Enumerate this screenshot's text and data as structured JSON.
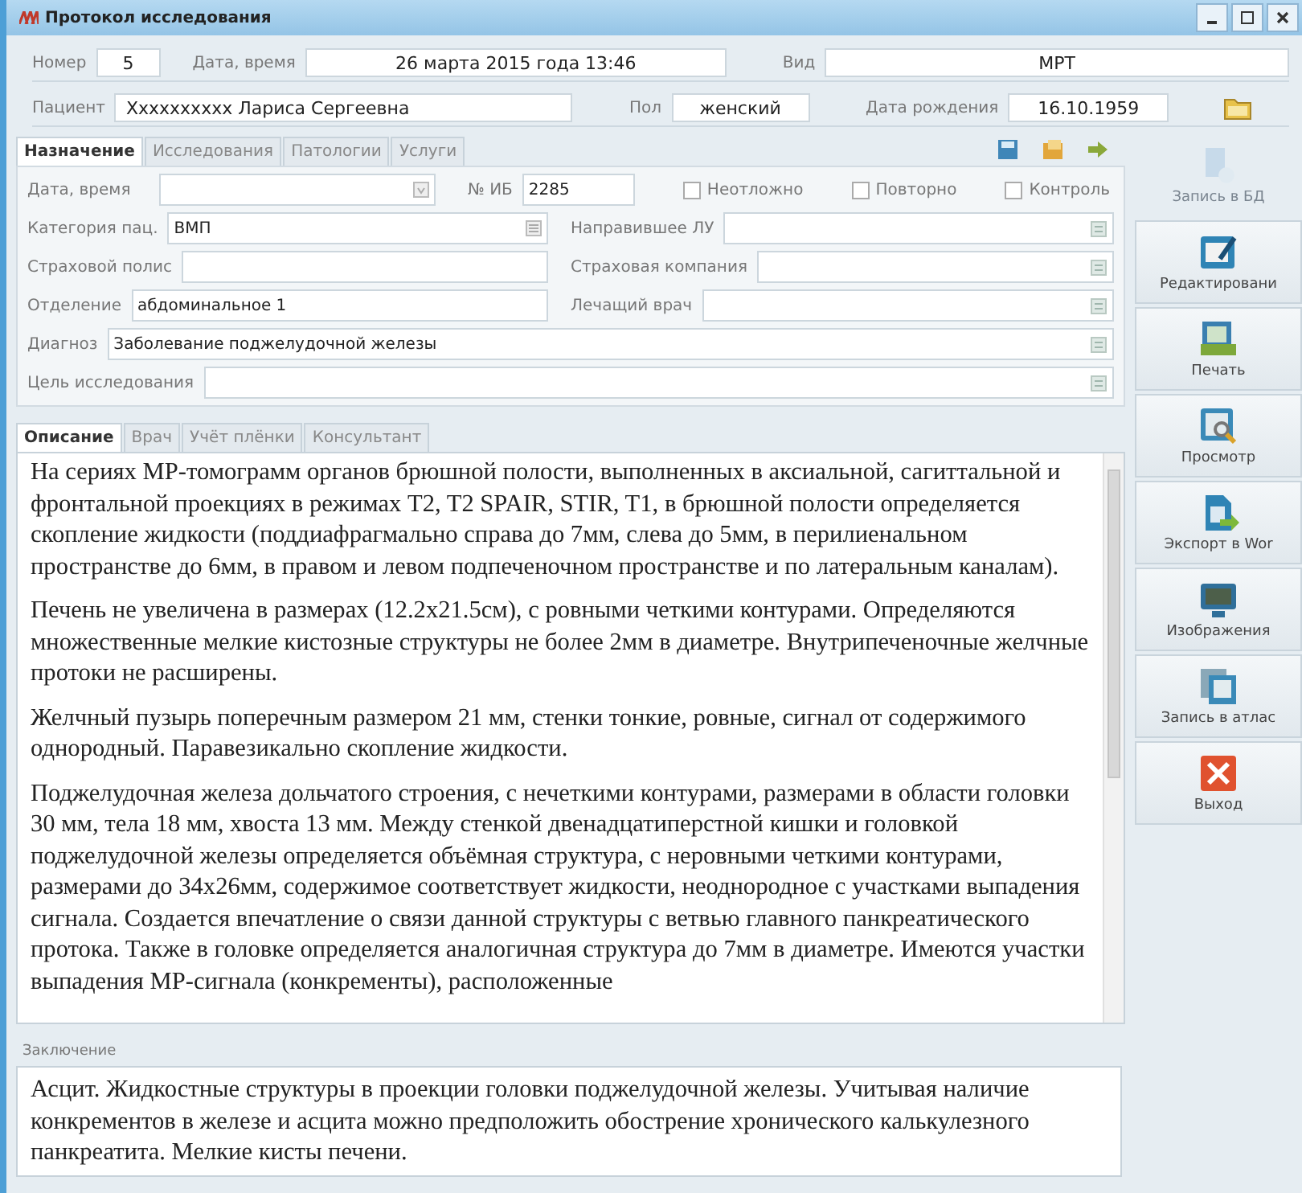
{
  "window": {
    "title": "Протокол исследования"
  },
  "header": {
    "number": {
      "label": "Номер",
      "value": "5"
    },
    "datetime": {
      "label": "Дата, время",
      "value": "26 марта 2015 года 13:46"
    },
    "type": {
      "label": "Вид",
      "value": "МРТ"
    },
    "patient": {
      "label": "Пациент",
      "value": "Xxxxxxxxxx Лариса Сергеевна"
    },
    "sex": {
      "label": "Пол",
      "value": "женский"
    },
    "birth": {
      "label": "Дата рождения",
      "value": "16.10.1959"
    }
  },
  "tabs": [
    {
      "label": "Назначение",
      "selected": true
    },
    {
      "label": "Исследования",
      "selected": false
    },
    {
      "label": "Патологии",
      "selected": false
    },
    {
      "label": "Услуги",
      "selected": false
    }
  ],
  "form": {
    "date": {
      "label": "Дата, время"
    },
    "ib": {
      "label": "№ ИБ",
      "value": "2285"
    },
    "checks": [
      {
        "label": "Неотложно",
        "checked": false
      },
      {
        "label": "Повторно",
        "checked": false
      },
      {
        "label": "Контроль",
        "checked": false
      }
    ],
    "category": {
      "label": "Категория пац.",
      "value": "ВМП"
    },
    "referrer": {
      "label": "Направившее ЛУ"
    },
    "policy": {
      "label": "Страховой полис"
    },
    "insurer": {
      "label": "Страховая компания"
    },
    "department": {
      "label": "Отделение",
      "value": "абдоминальное 1"
    },
    "doctor": {
      "label": "Лечащий врач"
    },
    "diagnosis": {
      "label": "Диагноз",
      "value": "Заболевание поджелудочной железы"
    },
    "purpose": {
      "label": "Цель исследования"
    }
  },
  "subtabs": [
    {
      "label": "Описание",
      "selected": true
    },
    {
      "label": "Врач",
      "selected": false
    },
    {
      "label": "Учёт плёнки",
      "selected": false
    },
    {
      "label": "Консультант",
      "selected": false
    }
  ],
  "description": [
    "На сериях МР-томограмм органов брюшной полости, выполненных в аксиальной, сагиттальной и фронтальной проекциях в режимах T2, T2 SPAIR, STIR, T1, в брюшной полости определяется скопление жидкости (поддиафрагмально справа до 7мм, слева до 5мм, в перилиенальном пространстве до 6мм, в правом и левом подпеченочном пространстве и по латеральным каналам).",
    "Печень не увеличена в размерах (12.2х21.5см), с ровными четкими контурами. Определяются множественные мелкие кистозные структуры не более 2мм в диаметре. Внутрипеченочные желчные протоки не расширены.",
    "Желчный пузырь поперечным размером 21 мм, стенки тонкие, ровные, сигнал от содержимого однородный. Паравезикально скопление жидкости.",
    "Поджелудочная железа дольчатого строения, с нечеткими контурами, размерами в области головки 30 мм, тела 18 мм, хвоста 13 мм. Между стенкой двенадцатиперстной кишки и головкой поджелудочной железы определяется объёмная структура,  с неровными четкими контурами, размерами до 34х26мм, содержимое соответствует жидкости, неоднородное с участками выпадения сигнала.  Создается впечатление о связи данной структуры с ветвью главного панкреатического протока. Также в головке определяется аналогичная структура до 7мм в диаметре. Имеются участки выпадения МР-сигнала (конкременты), расположенные"
  ],
  "conclusion": {
    "label": "Заключение",
    "text": "Асцит. Жидкостные структуры в проекции головки поджелудочной железы. Учитывая наличие конкрементов в железе и асцита можно предположить обострение хронического калькулезного панкреатита. Мелкие кисты печени."
  },
  "toolbar": [
    {
      "label": "Запись в БД",
      "disabled": true
    },
    {
      "label": "Редактировани",
      "disabled": false
    },
    {
      "label": "Печать",
      "disabled": false
    },
    {
      "label": "Просмотр",
      "disabled": false
    },
    {
      "label": "Экспорт в Wor",
      "disabled": false
    },
    {
      "label": "Изображения",
      "disabled": false
    },
    {
      "label": "Запись в атлас",
      "disabled": false
    },
    {
      "label": "Выход",
      "disabled": false
    }
  ]
}
